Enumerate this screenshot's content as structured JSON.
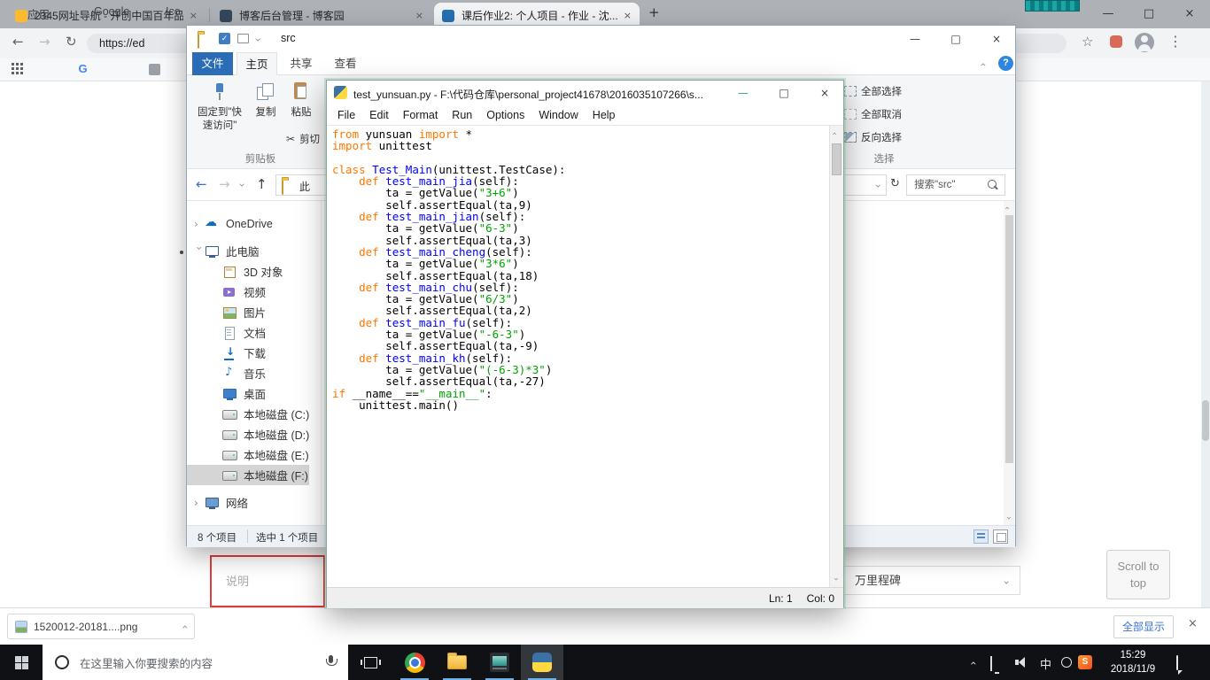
{
  "browser": {
    "tabs": [
      {
        "title": "2345网址导航 - 开创中国百年品..."
      },
      {
        "title": "博客后台管理 - 博客园"
      },
      {
        "title": "课后作业2: 个人项目 - 作业 - 沈..."
      }
    ],
    "tab_close_glyph": "×",
    "new_tab_glyph": "+",
    "window_controls": {
      "minimize": "—",
      "maximize": "□",
      "close": "×"
    },
    "toolbar": {
      "url": "https://ed"
    },
    "bookmarks_bar": {
      "apps_label": "应用",
      "google_letter": "G",
      "google_label": "Google",
      "ico_label": "Ico"
    },
    "page": {
      "note_label": "说明",
      "milestone_value": "万里程碑",
      "scroll_top_line1": "Scroll to",
      "scroll_top_line2": "top"
    },
    "download_shelf": {
      "file_name": "1520012-20181....png",
      "show_all_label": "全部显示",
      "close_glyph": "×"
    }
  },
  "explorer": {
    "title": "src",
    "window_controls": {
      "minimize": "—",
      "maximize": "□",
      "close": "×"
    },
    "ribbon_tabs": [
      {
        "label": "文件"
      },
      {
        "label": "主页"
      },
      {
        "label": "共享"
      },
      {
        "label": "查看"
      }
    ],
    "ribbon": {
      "pin_line1": "固定到\"快",
      "pin_line2": "速访问\"",
      "copy_label": "复制",
      "paste_label": "粘贴",
      "cut_label": "剪切",
      "clipboard_group_label": "剪贴板",
      "select_all_label": "全部选择",
      "select_none_label": "全部取消",
      "invert_selection_label": "反向选择",
      "select_group_label": "选择",
      "help_glyph": "?"
    },
    "nav": {
      "address_text": "此",
      "search_text": "搜索\"src\""
    },
    "sidebar": {
      "items": [
        {
          "label": "OneDrive",
          "icon": "ic-onedrive",
          "level": 0,
          "chevron": "right",
          "gap_before": true
        },
        {
          "label": "此电脑",
          "icon": "ic-computer",
          "level": 0,
          "chevron": "down",
          "gap_before": true
        },
        {
          "label": "3D 对象",
          "icon": "ic-3d",
          "level": 1
        },
        {
          "label": "视频",
          "icon": "ic-video",
          "level": 1
        },
        {
          "label": "图片",
          "icon": "ic-picture",
          "level": 1
        },
        {
          "label": "文档",
          "icon": "ic-document",
          "level": 1
        },
        {
          "label": "下载",
          "icon": "ic-download",
          "level": 1
        },
        {
          "label": "音乐",
          "icon": "ic-music",
          "level": 1
        },
        {
          "label": "桌面",
          "icon": "ic-desktop",
          "level": 1
        },
        {
          "label": "本地磁盘 (C:)",
          "icon": "ic-disk",
          "level": 1
        },
        {
          "label": "本地磁盘 (D:)",
          "icon": "ic-disk",
          "level": 1
        },
        {
          "label": "本地磁盘 (E:)",
          "icon": "ic-disk",
          "level": 1
        },
        {
          "label": "本地磁盘 (F:)",
          "icon": "ic-disk",
          "level": 1,
          "selected": true
        },
        {
          "label": "网络",
          "icon": "ic-network",
          "level": 0,
          "chevron": "right",
          "gap_before": true
        }
      ]
    },
    "status": {
      "count": "8 个项目",
      "selection": "选中 1 个项目"
    }
  },
  "idle": {
    "title": "test_yunsuan.py - F:\\代码仓库\\personal_project41678\\2016035107266\\s...",
    "window_controls": {
      "minimize": "—",
      "maximize": "□",
      "close": "×"
    },
    "menus": [
      "File",
      "Edit",
      "Format",
      "Run",
      "Options",
      "Window",
      "Help"
    ],
    "status": {
      "line": "Ln: 1",
      "col": "Col: 0"
    },
    "code_lines": [
      [
        {
          "t": "from",
          "c": "k"
        },
        {
          "t": " yunsuan ",
          "c": "p"
        },
        {
          "t": "import",
          "c": "k"
        },
        {
          "t": " *",
          "c": "p"
        }
      ],
      [
        {
          "t": "import",
          "c": "k"
        },
        {
          "t": " unittest",
          "c": "p"
        }
      ],
      [],
      [
        {
          "t": "class",
          "c": "k"
        },
        {
          "t": " ",
          "c": "p"
        },
        {
          "t": "Test_Main",
          "c": "d"
        },
        {
          "t": "(unittest.TestCase):",
          "c": "p"
        }
      ],
      [
        {
          "t": "    ",
          "c": "p"
        },
        {
          "t": "def",
          "c": "k"
        },
        {
          "t": " ",
          "c": "p"
        },
        {
          "t": "test_main_jia",
          "c": "d"
        },
        {
          "t": "(self):",
          "c": "p"
        }
      ],
      [
        {
          "t": "        ta = getValue(",
          "c": "p"
        },
        {
          "t": "\"3+6\"",
          "c": "s"
        },
        {
          "t": ")",
          "c": "p"
        }
      ],
      [
        {
          "t": "        self.assertEqual(ta,9)",
          "c": "p"
        }
      ],
      [
        {
          "t": "    ",
          "c": "p"
        },
        {
          "t": "def",
          "c": "k"
        },
        {
          "t": " ",
          "c": "p"
        },
        {
          "t": "test_main_jian",
          "c": "d"
        },
        {
          "t": "(self):",
          "c": "p"
        }
      ],
      [
        {
          "t": "        ta = getValue(",
          "c": "p"
        },
        {
          "t": "\"6-3\"",
          "c": "s"
        },
        {
          "t": ")",
          "c": "p"
        }
      ],
      [
        {
          "t": "        self.assertEqual(ta,3)",
          "c": "p"
        }
      ],
      [
        {
          "t": "    ",
          "c": "p"
        },
        {
          "t": "def",
          "c": "k"
        },
        {
          "t": " ",
          "c": "p"
        },
        {
          "t": "test_main_cheng",
          "c": "d"
        },
        {
          "t": "(self):",
          "c": "p"
        }
      ],
      [
        {
          "t": "        ta = getValue(",
          "c": "p"
        },
        {
          "t": "\"3*6\"",
          "c": "s"
        },
        {
          "t": ")",
          "c": "p"
        }
      ],
      [
        {
          "t": "        self.assertEqual(ta,18)",
          "c": "p"
        }
      ],
      [
        {
          "t": "    ",
          "c": "p"
        },
        {
          "t": "def",
          "c": "k"
        },
        {
          "t": " ",
          "c": "p"
        },
        {
          "t": "test_main_chu",
          "c": "d"
        },
        {
          "t": "(self):",
          "c": "p"
        }
      ],
      [
        {
          "t": "        ta = getValue(",
          "c": "p"
        },
        {
          "t": "\"6/3\"",
          "c": "s"
        },
        {
          "t": ")",
          "c": "p"
        }
      ],
      [
        {
          "t": "        self.assertEqual(ta,2)",
          "c": "p"
        }
      ],
      [
        {
          "t": "    ",
          "c": "p"
        },
        {
          "t": "def",
          "c": "k"
        },
        {
          "t": " ",
          "c": "p"
        },
        {
          "t": "test_main_fu",
          "c": "d"
        },
        {
          "t": "(self):",
          "c": "p"
        }
      ],
      [
        {
          "t": "        ta = getValue(",
          "c": "p"
        },
        {
          "t": "\"-6-3\"",
          "c": "s"
        },
        {
          "t": ")",
          "c": "p"
        }
      ],
      [
        {
          "t": "        self.assertEqual(ta,-9)",
          "c": "p"
        }
      ],
      [
        {
          "t": "    ",
          "c": "p"
        },
        {
          "t": "def",
          "c": "k"
        },
        {
          "t": " ",
          "c": "p"
        },
        {
          "t": "test_main_kh",
          "c": "d"
        },
        {
          "t": "(self):",
          "c": "p"
        }
      ],
      [
        {
          "t": "        ta = getValue(",
          "c": "p"
        },
        {
          "t": "\"(-6-3)*3\"",
          "c": "s"
        },
        {
          "t": ")",
          "c": "p"
        }
      ],
      [
        {
          "t": "        self.assertEqual(ta,-27)",
          "c": "p"
        }
      ],
      [
        {
          "t": "if",
          "c": "k"
        },
        {
          "t": " __name__==",
          "c": "p"
        },
        {
          "t": "\"__main__\"",
          "c": "s"
        },
        {
          "t": ":",
          "c": "p"
        }
      ],
      [
        {
          "t": "    unittest.main()",
          "c": "p"
        }
      ]
    ]
  },
  "taskbar": {
    "search_placeholder": "在这里输入你要搜索的内容",
    "language_indicator": "中",
    "sogou_letter": "S",
    "clock_time": "15:29",
    "clock_date": "2018/11/9"
  }
}
